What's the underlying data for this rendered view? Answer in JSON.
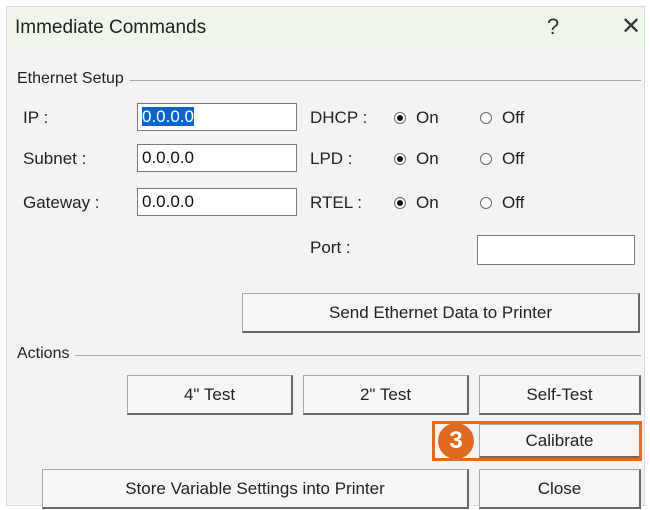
{
  "window": {
    "title": "Immediate Commands",
    "help": "?",
    "close": "✕"
  },
  "ethernet": {
    "group_label": "Ethernet Setup",
    "ip_label": "IP :",
    "ip_value": "0.0.0.0",
    "subnet_label": "Subnet :",
    "subnet_value": "0.0.0.0",
    "gateway_label": "Gateway :",
    "gateway_value": "0.0.0.0",
    "dhcp_label": "DHCP :",
    "lpd_label": "LPD :",
    "rtel_label": "RTEL :",
    "on_label": "On",
    "off_label": "Off",
    "dhcp_selected": "On",
    "lpd_selected": "On",
    "rtel_selected": "On",
    "port_label": "Port :",
    "port_value": "",
    "send_button": "Send Ethernet Data to Printer"
  },
  "actions": {
    "group_label": "Actions",
    "test4_button": "4\" Test",
    "test2_button": "2\" Test",
    "selftest_button": "Self-Test",
    "calibrate_button": "Calibrate",
    "store_button": "Store Variable Settings into Printer",
    "close_button": "Close"
  },
  "annotation": {
    "step_number": "3",
    "color": "#e06b1f"
  }
}
